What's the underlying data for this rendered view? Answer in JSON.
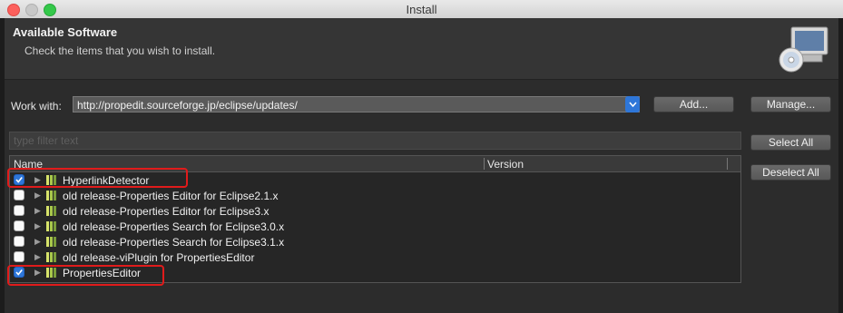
{
  "window": {
    "title": "Install"
  },
  "header": {
    "title": "Available Software",
    "description": "Check the items that you wish to install."
  },
  "work_with": {
    "label": "Work with:",
    "url": "http://propedit.sourceforge.jp/eclipse/updates/",
    "add_label": "Add...",
    "manage_label": "Manage..."
  },
  "filter": {
    "placeholder": "type filter text"
  },
  "table": {
    "columns": {
      "name": "Name",
      "version": "Version"
    },
    "rows": [
      {
        "label": "HyperlinkDetector",
        "checked": true
      },
      {
        "label": "old release-Properties Editor for Eclipse2.1.x",
        "checked": false
      },
      {
        "label": "old release-Properties Editor for Eclipse3.x",
        "checked": false
      },
      {
        "label": "old release-Properties Search for Eclipse3.0.x",
        "checked": false
      },
      {
        "label": "old release-Properties Search for Eclipse3.1.x",
        "checked": false
      },
      {
        "label": "old release-viPlugin for PropertiesEditor",
        "checked": false
      },
      {
        "label": "PropertiesEditor",
        "checked": true
      }
    ]
  },
  "side_buttons": {
    "select_all": "Select All",
    "deselect_all": "Deselect All"
  },
  "colors": {
    "accent": "#2e76d8",
    "highlight": "#e01b1b",
    "background": "#2c2c2c"
  },
  "icons": [
    "close-icon",
    "minimize-icon",
    "maximize-icon",
    "install-cd-icon",
    "chevron-down-icon",
    "expand-triangle-icon",
    "feature-package-icon"
  ]
}
